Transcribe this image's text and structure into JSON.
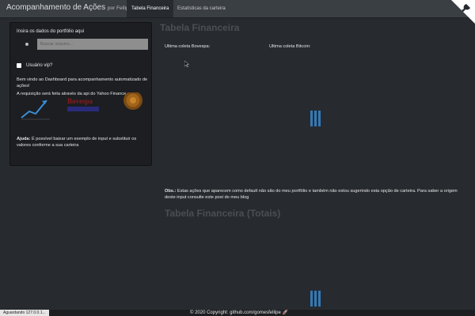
{
  "navbar": {
    "title": "Acompanhamento de Ações",
    "subtitle": "por Fellipe Gomes",
    "tabs": [
      {
        "label": "Tabela Financeira",
        "active": true
      },
      {
        "label": "Estatísticas da carteira",
        "active": false
      }
    ]
  },
  "sidebar": {
    "portfolio_label": "Insira os dados do portfólio aqui",
    "upload_placeholder": "Buscar arquivo...",
    "vip_label": "Usuário vip?",
    "vip_checked": false,
    "welcome_text": "Bem vindo ao Dashboard para acompanhamento automatizado de ações!",
    "api_text": "A requisição será feita através da api do Yahoo Finance.",
    "logo_text": "Bovespa",
    "help_title": "Ajuda:",
    "help_text": "É possível baixar um exemplo de input e substituir os valores conforme a sua carteira"
  },
  "main": {
    "title": "Tabela Financeira",
    "coleta_bovespa": "Ultima coleta Bovespa:",
    "coleta_bitcoin": "Ultima coleta Bitcoin:",
    "obs_title": "Obs.:",
    "obs_text": "Estas ações que aparecem como default não são do meu portfólio e também não estou sugerindo esta opção de carteira. Para saber a origem deste input consulte este post do meu blog",
    "totals_title": "Tabela Financeira (Totais)"
  },
  "footer": {
    "status": "Aguardando 127.0.0.1...",
    "copyright": "© 2020 Copyright: github.com/gomesfellipe 🚀"
  },
  "colors": {
    "background": "#272b30",
    "navbar": "#3a3f44",
    "sidebar": "#1c1e22",
    "loader": "#337ab7"
  }
}
